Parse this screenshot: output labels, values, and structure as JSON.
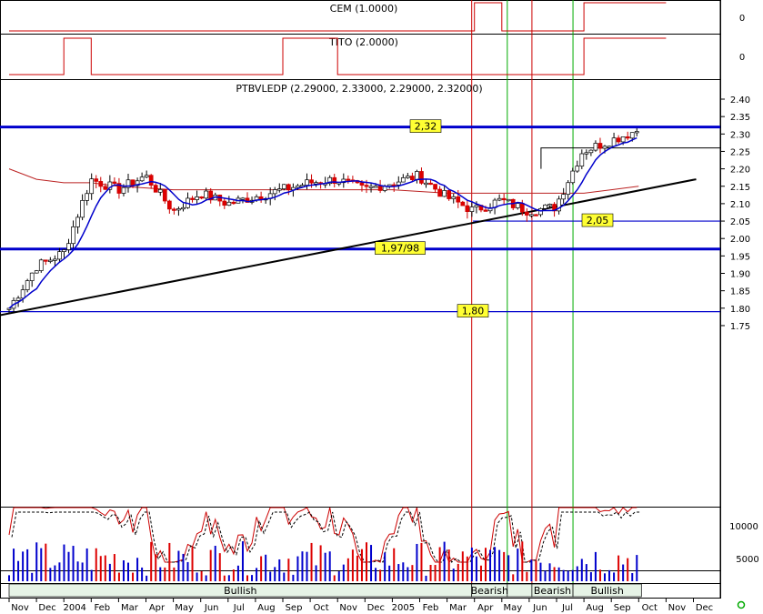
{
  "chart_data": {
    "type": "candlestick",
    "panels": [
      {
        "id": "cem",
        "title": "CEM (1.0000)",
        "y_ticks": [
          "0"
        ]
      },
      {
        "id": "tito",
        "title": "TITO (2.0000)",
        "y_ticks": [
          "0"
        ]
      },
      {
        "id": "price",
        "title": "PTBVLEDP (2.29000, 2.33000, 2.29000, 2.32000)",
        "y_ticks": [
          "2.40",
          "2.35",
          "2.30",
          "2.25",
          "2.20",
          "2.15",
          "2.10",
          "2.05",
          "2.00",
          "1.95",
          "1.90",
          "1.85",
          "1.80",
          "1.75"
        ],
        "ylim": [
          1.715,
          2.415
        ]
      },
      {
        "id": "oscillator",
        "title": "",
        "y_ticks": []
      },
      {
        "id": "volume",
        "title": "",
        "y_ticks": [
          "10000",
          "5000"
        ]
      }
    ],
    "x_ticks": [
      "Nov",
      "Dec",
      "2004",
      "Feb",
      "Mar",
      "Apr",
      "May",
      "Jun",
      "Jul",
      "Aug",
      "Sep",
      "Oct",
      "Nov",
      "Dec",
      "2005",
      "Feb",
      "Mar",
      "Apr",
      "May",
      "Jun",
      "Jul",
      "Aug",
      "Sep",
      "Oct",
      "Nov",
      "Dec"
    ],
    "levels": [
      {
        "label": "2,32",
        "value": 2.32,
        "color": "#0000cc",
        "bold": true
      },
      {
        "label": "2,05",
        "value": 2.05,
        "color": "#0000cc",
        "bold": false
      },
      {
        "label": "1,97/98",
        "value": 1.97,
        "color": "#0000cc",
        "bold": true
      },
      {
        "label": "1,80",
        "value": 1.79,
        "color": "#0000cc",
        "bold": false
      }
    ],
    "trendline": {
      "start": [
        0,
        1.78
      ],
      "end": [
        25.1,
        2.17
      ],
      "color": "#000000"
    },
    "resistance_short": {
      "value": 2.26,
      "start_month": 19.1
    },
    "signals": [
      {
        "type": "bearish",
        "month": 16.9,
        "color": "#cc0000"
      },
      {
        "type": "bullish",
        "month": 18.2,
        "color": "#00aa00"
      },
      {
        "type": "bearish",
        "month": 19.1,
        "color": "#cc0000"
      },
      {
        "type": "bullish",
        "month": 20.6,
        "color": "#00aa00"
      }
    ],
    "regimes": [
      {
        "label": "Bullish",
        "start_month": 0,
        "end_month": 16.9
      },
      {
        "label": "Bearish",
        "start_month": 16.9,
        "end_month": 18.2
      },
      {
        "label": "",
        "start_month": 18.2,
        "end_month": 19.1
      },
      {
        "label": "Bearish",
        "start_month": 19.1,
        "end_month": 20.6
      },
      {
        "label": "Bullish",
        "start_month": 20.6,
        "end_month": 23.1
      }
    ],
    "monthly_close": [
      1.8,
      1.92,
      1.96,
      2.17,
      2.14,
      2.18,
      2.08,
      2.13,
      2.1,
      2.12,
      2.14,
      2.16,
      2.17,
      2.14,
      2.16,
      2.18,
      2.12,
      2.08,
      2.11,
      2.08,
      2.09,
      2.25,
      2.28,
      2.31
    ],
    "ma_long": [
      2.2,
      2.17,
      2.16,
      2.16,
      2.15,
      2.145,
      2.14,
      2.14,
      2.14,
      2.14,
      2.14,
      2.14,
      2.14,
      2.14,
      2.14,
      2.135,
      2.13,
      2.13,
      2.13,
      2.13,
      2.13,
      2.13,
      2.14,
      2.15
    ],
    "cem_signal": [
      -1,
      -1,
      -1,
      -1,
      -1,
      -1,
      -1,
      -1,
      -1,
      -1,
      -1,
      -1,
      -1,
      -1,
      -1,
      -1,
      -1,
      1,
      -1,
      -1,
      -1,
      1,
      1,
      1
    ],
    "tito_signal": [
      -1,
      -1,
      1,
      -1,
      -1,
      -1,
      -1,
      -1,
      -1,
      -1,
      1,
      1,
      -1,
      -1,
      -1,
      -1,
      -1,
      -1,
      -1,
      -1,
      -1,
      1,
      1,
      1
    ]
  }
}
